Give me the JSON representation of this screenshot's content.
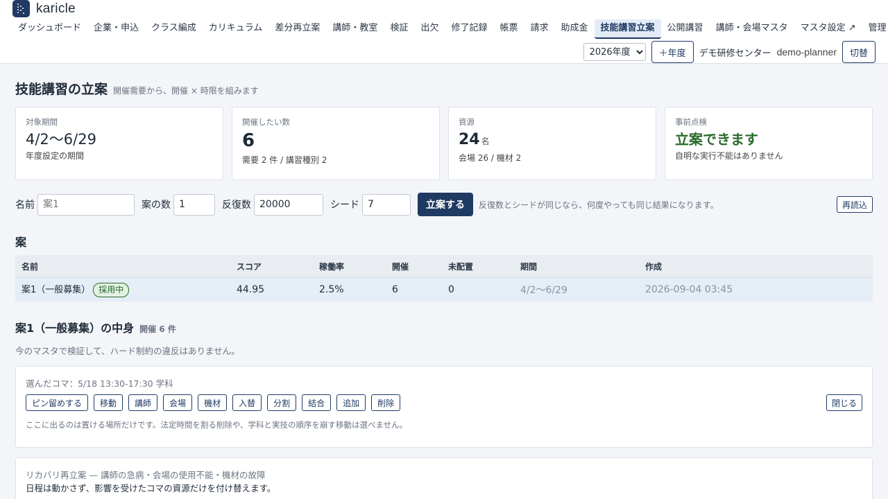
{
  "app": {
    "name": "karicle"
  },
  "nav": [
    {
      "label": "ダッシュボード"
    },
    {
      "label": "企業・申込"
    },
    {
      "label": "クラス編成"
    },
    {
      "label": "カリキュラム"
    },
    {
      "label": "差分再立案"
    },
    {
      "label": "講師・教室"
    },
    {
      "label": "検証"
    },
    {
      "label": "出欠"
    },
    {
      "label": "修了記録"
    },
    {
      "label": "帳票"
    },
    {
      "label": "請求"
    },
    {
      "label": "助成金"
    },
    {
      "label": "技能講習立案",
      "active": true
    },
    {
      "label": "公開講習"
    },
    {
      "label": "講師・会場マスタ"
    },
    {
      "label": "マスタ設定 ↗"
    },
    {
      "label": "管理"
    }
  ],
  "header": {
    "year_selected": "2026年度",
    "add_year_label": "＋年度",
    "org_name": "デモ研修センター",
    "user_name": "demo-planner",
    "switch_label": "切替"
  },
  "page": {
    "title": "技能講習の立案",
    "subtitle": "開催需要から、開催 × 時限を組みます"
  },
  "cards": {
    "period": {
      "label": "対象期間",
      "value": "4/2〜6/29",
      "note": "年度設定の期間"
    },
    "count": {
      "label": "開催したい数",
      "value": "6",
      "note": "需要 2 件 / 講習種別 2"
    },
    "resources": {
      "label": "資源",
      "value": "24",
      "unit": "名",
      "note": "会場 26 / 機材 2"
    },
    "precheck": {
      "label": "事前点検",
      "value": "立案できます",
      "note": "自明な実行不能はありません"
    }
  },
  "form": {
    "name_label": "名前",
    "name_placeholder": "案1",
    "plans_label": "案の数",
    "plans_value": "1",
    "iterations_label": "反復数",
    "iterations_value": "20000",
    "seed_label": "シード",
    "seed_value": "7",
    "submit_label": "立案する",
    "hint": "反復数とシードが同じなら、何度やっても同じ結果になります。",
    "reload_label": "再読込"
  },
  "plans": {
    "title": "案",
    "columns": [
      "名前",
      "スコア",
      "稼働率",
      "開催",
      "未配置",
      "期間",
      "作成"
    ],
    "rows": [
      {
        "name": "案1（一般募集）",
        "badge": "採用中",
        "score": "44.95",
        "utilization": "2.5%",
        "sessions": "6",
        "unassigned": "0",
        "period": "4/2〜6/29",
        "created": "2026-09-04 03:45"
      }
    ]
  },
  "detail": {
    "title": "案1（一般募集）の中身",
    "sub": "開催 6 件",
    "verify_note": "今のマスタで検証して、ハード制約の違反はありません。",
    "selected": "選んだコマ：5/18 13:30-17:30 学科",
    "actions": [
      "ピン留めする",
      "移動",
      "講師",
      "会場",
      "機材",
      "入替",
      "分割",
      "結合",
      "追加",
      "削除"
    ],
    "close_label": "閉じる",
    "action_note": "ここに出るのは置ける場所だけです。法定時間を割る削除や、学科と実技の順序を崩す移動は選べません。"
  },
  "recovery": {
    "title": "リカバリ再立案 — 講師の急病・会場の使用不能・機材の故障",
    "note": "日程は動かさず、影響を受けたコマの資源だけを付け替えます。"
  }
}
